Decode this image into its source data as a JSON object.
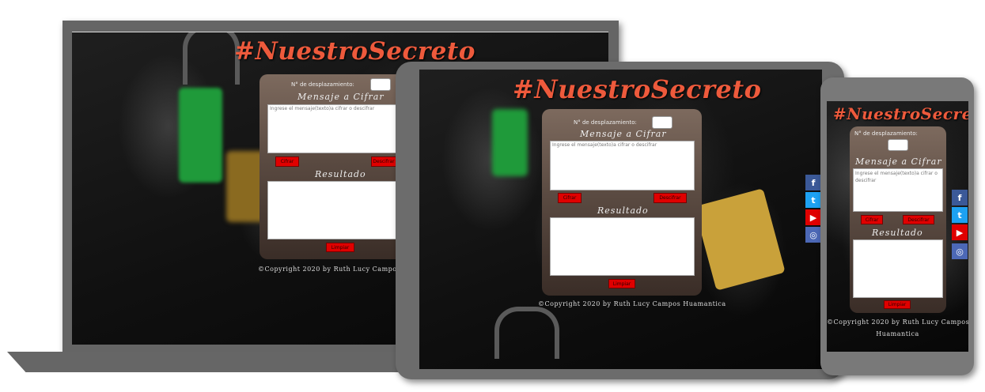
{
  "app": {
    "title": "#NuestroSecreto",
    "shift_label": "N° de desplazamiento:",
    "cipher_heading": "Mensaje a Cifrar",
    "message_placeholder": "Ingrese el mensaje(texto)a cifrar o descifrar",
    "encrypt_label": "Cifrar",
    "decrypt_label": "Descifrar",
    "result_heading": "Resultado",
    "clear_label": "Limpiar",
    "copyright": "©Copyright 2020 by Ruth Lucy Campos Huamantica",
    "copyright_line1": "©Copyright 2020 by Ruth Lucy Campos",
    "copyright_line2": "Huamantica"
  },
  "social": {
    "icons": [
      "facebook-icon",
      "twitter-icon",
      "youtube-icon",
      "instagram-icon"
    ],
    "colors": {
      "facebook": "#3b5998",
      "twitter": "#1da1f2",
      "youtube": "#e00000",
      "instagram": "#4c68b6"
    }
  },
  "theme": {
    "title_color": "#ee5a3c",
    "button_color": "#e00000",
    "frame_color": "#6c6c6c"
  }
}
